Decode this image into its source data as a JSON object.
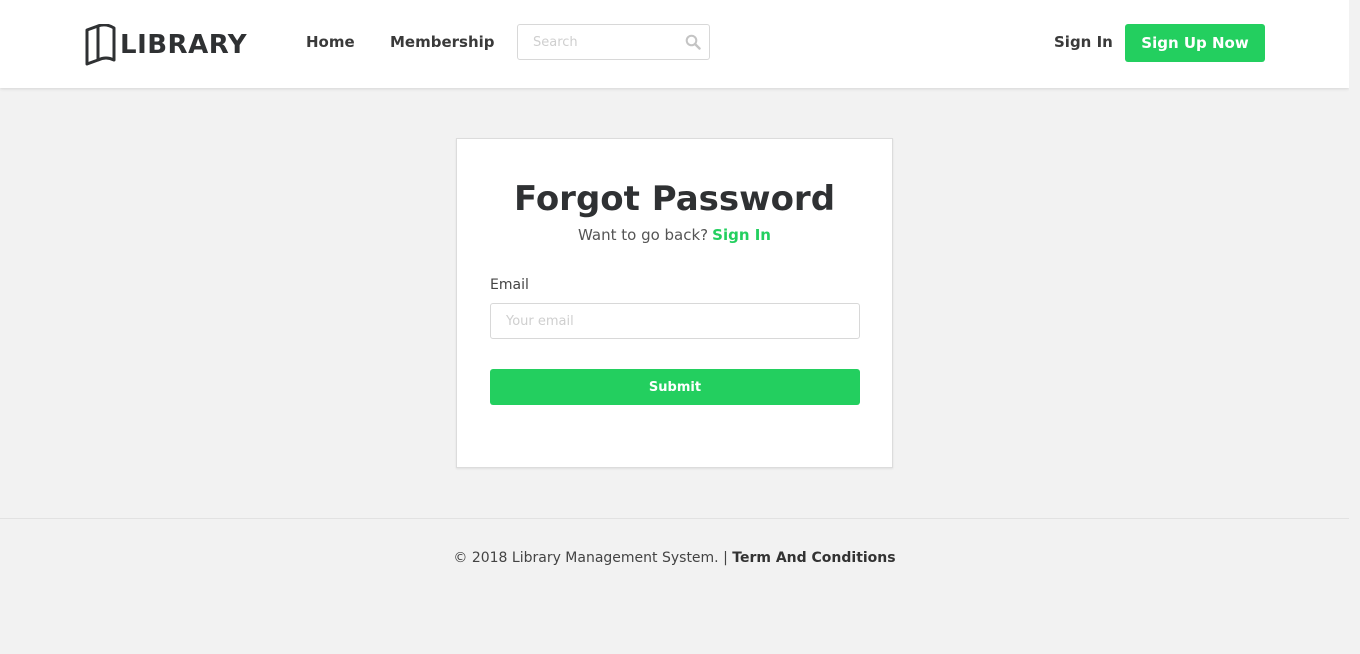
{
  "header": {
    "logo_text": "LIBRARY",
    "nav": [
      {
        "label": "Home"
      },
      {
        "label": "Membership"
      }
    ],
    "search": {
      "placeholder": "Search",
      "value": ""
    },
    "sign_in_label": "Sign In",
    "sign_up_label": "Sign Up Now"
  },
  "form": {
    "title": "Forgot Password",
    "back_prompt": "Want to go back?",
    "back_link": "Sign In",
    "email_label": "Email",
    "email_placeholder": "Your email",
    "email_value": "",
    "submit_label": "Submit"
  },
  "footer": {
    "copyright": "© 2018 Library Management System. |",
    "terms_link": "Term And Conditions"
  },
  "colors": {
    "accent": "#23cf5f",
    "background": "#f2f2f2",
    "text_dark": "#2f3133"
  },
  "icons": {
    "logo": "open-book-icon",
    "search": "search-icon"
  }
}
